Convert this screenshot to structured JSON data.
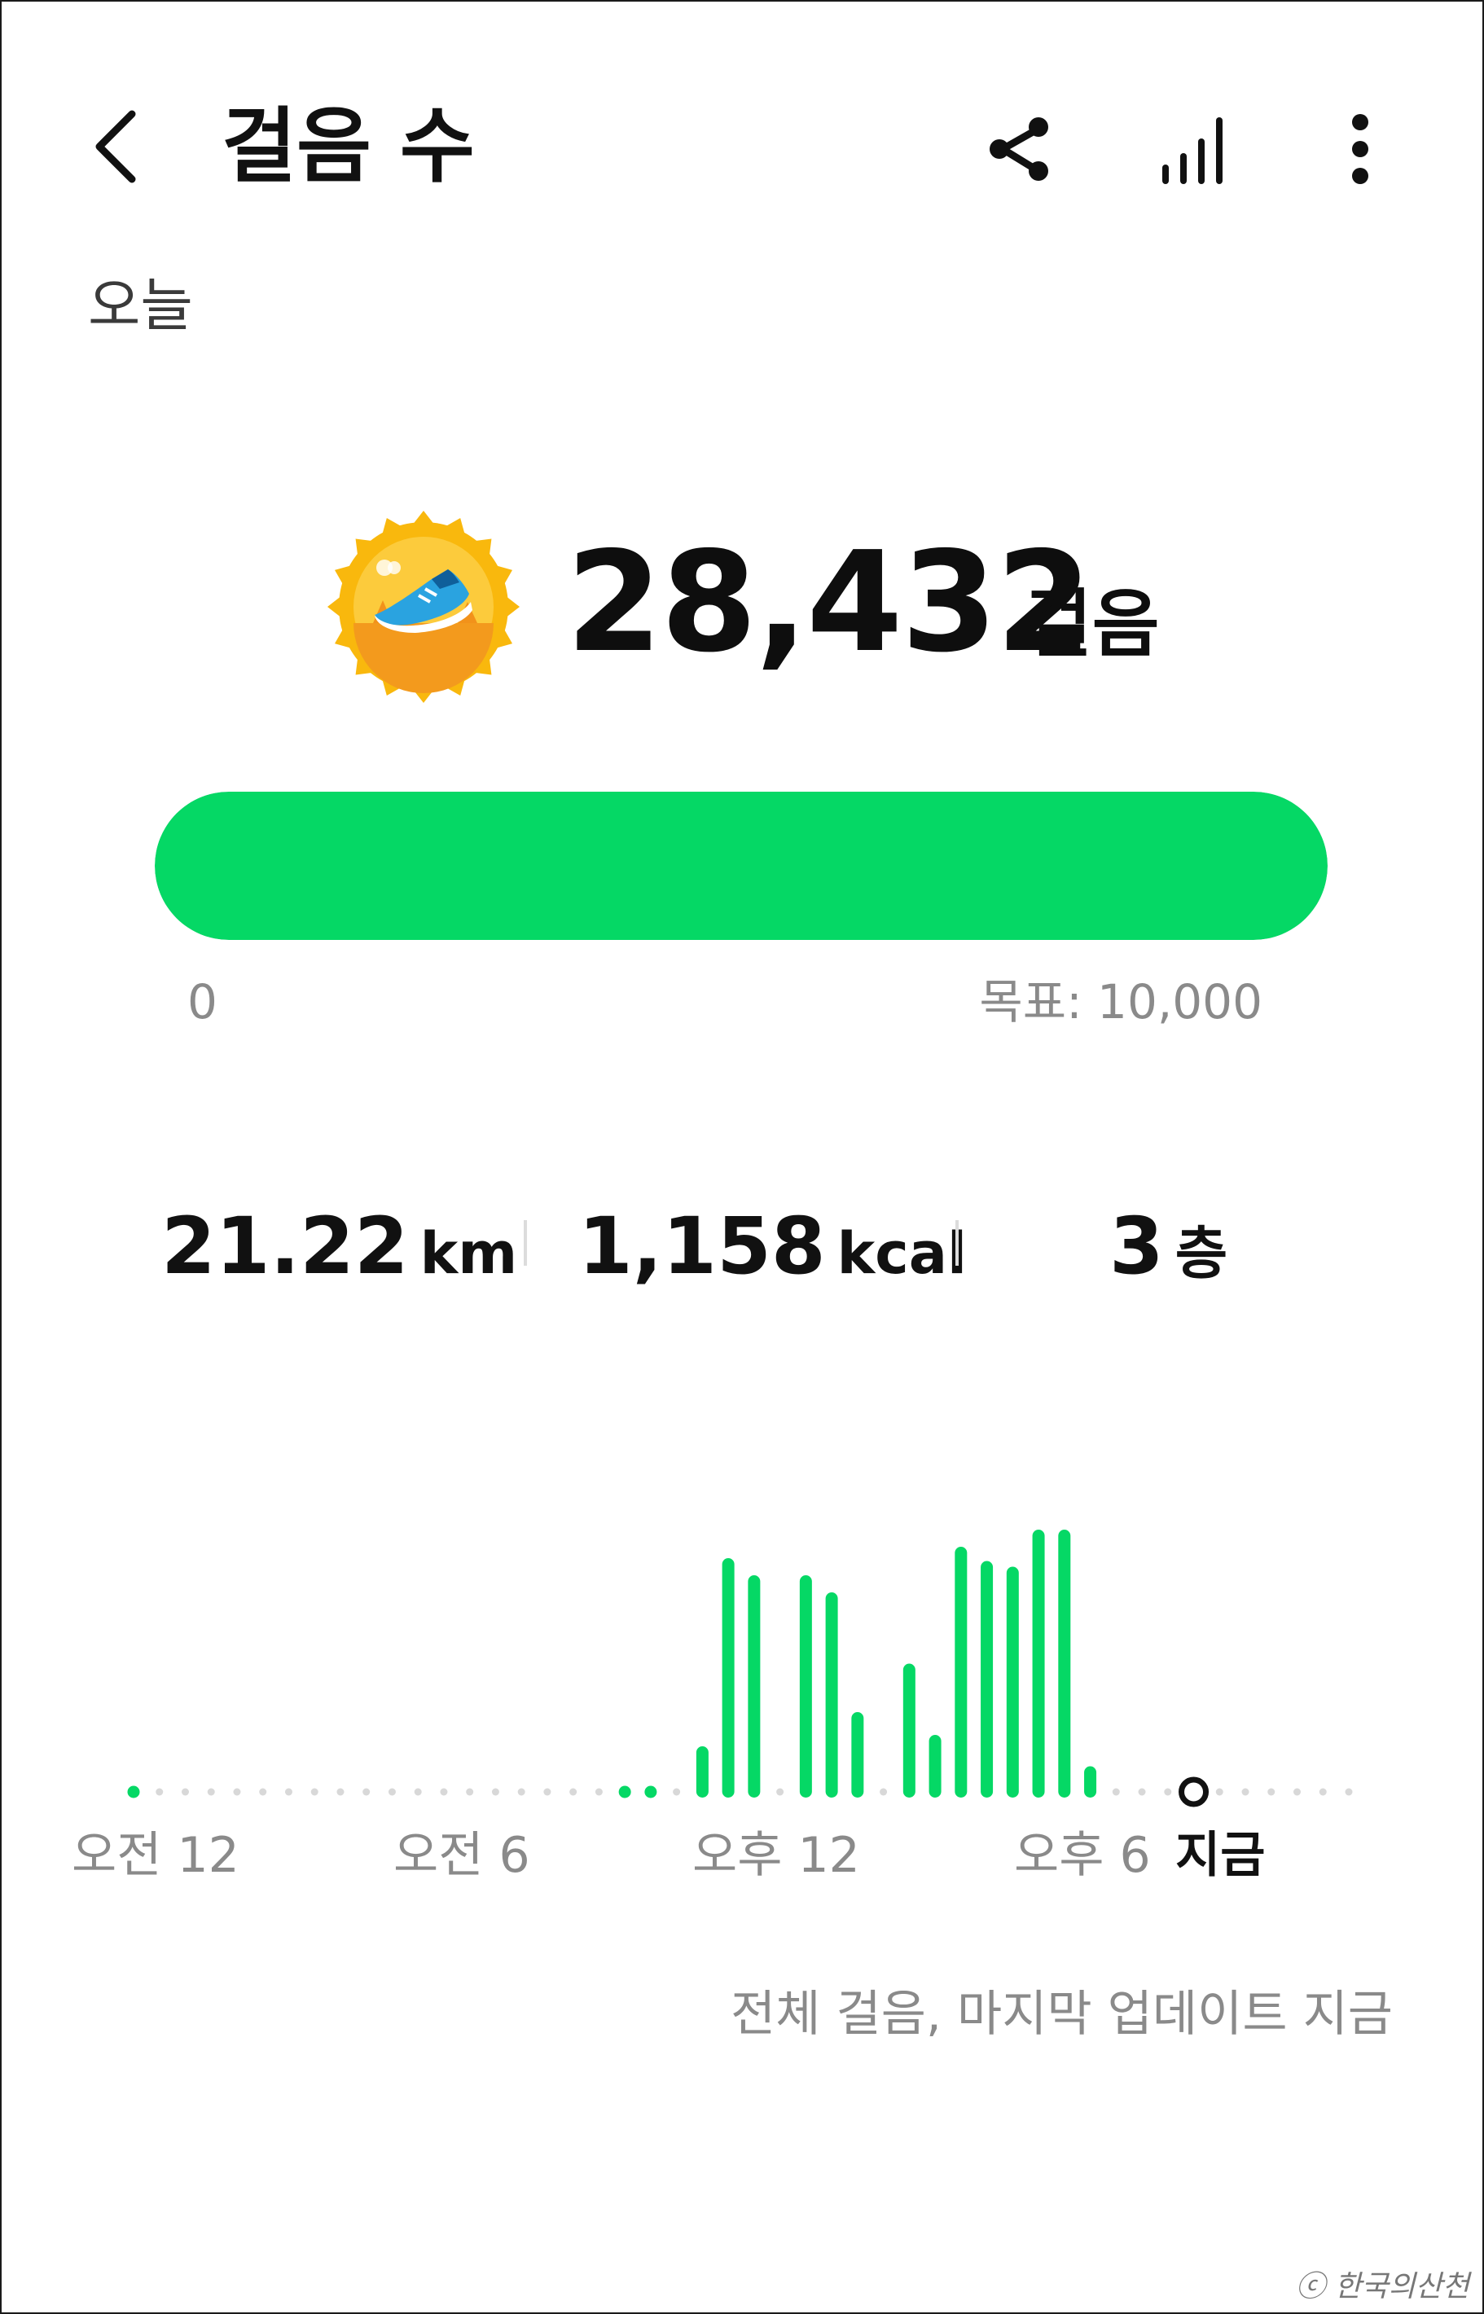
{
  "header": {
    "title": "걸음 수",
    "back_icon": "chevron-left-icon",
    "share_icon": "share-icon",
    "trends_icon": "signal-bars-icon",
    "more_icon": "more-vertical-icon"
  },
  "date_label": "오늘",
  "summary": {
    "badge_icon": "running-shoe-badge-icon",
    "steps": "28,432",
    "steps_unit": "걸음",
    "progress_fraction": 1.0,
    "progress_min": "0",
    "progress_goal": "목표: 10,000",
    "accent_color": "#05d865"
  },
  "stats": {
    "distance_value": "21.22",
    "distance_unit": "km",
    "calories_value": "1,158",
    "calories_unit": "kcal",
    "floors_value": "3",
    "floors_unit": "층"
  },
  "chart_data": {
    "type": "bar",
    "bar_color": "#05d865",
    "empty_dot_color": "#d8d8d8",
    "slots": 48,
    "values": [
      0.02,
      0,
      0,
      0,
      0,
      0,
      0,
      0,
      0,
      0,
      0,
      0,
      0,
      0,
      0,
      0,
      0,
      0,
      0,
      0.03,
      0.03,
      0,
      0.16,
      0.82,
      0.76,
      0,
      0.76,
      0.7,
      0.28,
      0,
      0.45,
      0.2,
      0.86,
      0.81,
      0.79,
      0.92,
      0.92,
      0.09,
      0,
      0,
      0,
      0,
      0,
      0,
      0,
      0,
      0,
      0
    ],
    "ylim": [
      0,
      1
    ],
    "current_slot": 41,
    "x_tick_labels": [
      "오전 12",
      "오전 6",
      "오후 12",
      "오후 6"
    ],
    "current_label": "지금"
  },
  "footer_note": "전체 걸음, 마지막 업데이트 지금",
  "watermark": "ⓒ 한국의산천"
}
